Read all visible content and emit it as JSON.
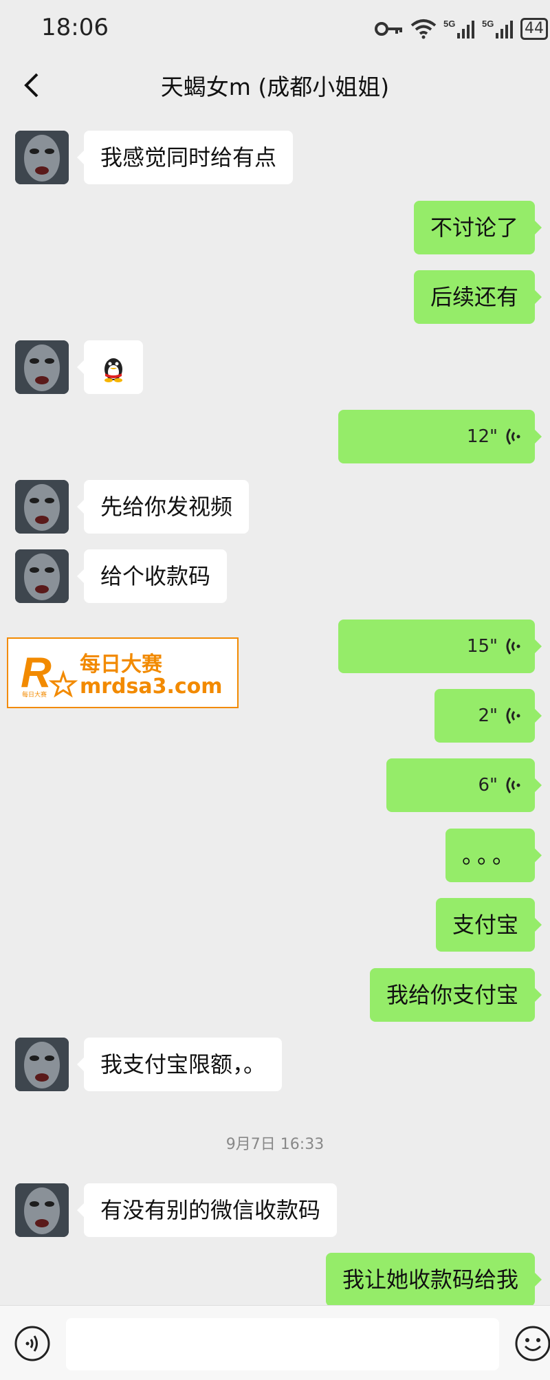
{
  "status": {
    "time": "18:06",
    "network1": "5G",
    "network2": "5G",
    "battery": "44"
  },
  "header": {
    "title": "天蝎女m (成都小姐姐)"
  },
  "messages": [
    {
      "side": "left",
      "text": "我感觉同时给有点"
    },
    {
      "side": "right",
      "text": "不讨论了"
    },
    {
      "side": "right",
      "text": "后续还有"
    },
    {
      "side": "left",
      "type": "sticker",
      "icon": "qq-penguin-icon"
    },
    {
      "side": "right",
      "type": "voice",
      "duration": "12\""
    },
    {
      "side": "left",
      "text": "先给你发视频"
    },
    {
      "side": "left",
      "text": "给个收款码"
    },
    {
      "side": "right",
      "type": "voice",
      "duration": "15\""
    },
    {
      "side": "right",
      "type": "voice",
      "duration": "2\""
    },
    {
      "side": "right",
      "type": "voice",
      "duration": "6\""
    },
    {
      "side": "right",
      "text": "。。。"
    },
    {
      "side": "right",
      "text": "支付宝"
    },
    {
      "side": "right",
      "text": "我给你支付宝"
    },
    {
      "side": "left",
      "text": "我支付宝限额，。"
    },
    {
      "side": "left",
      "text": "有没有别的微信收款码"
    },
    {
      "side": "right",
      "text": "我让她收款码给我"
    }
  ],
  "timestamp": "9月7日 16:33",
  "watermark": {
    "logo_letter": "R",
    "logo_sub": "每日大赛",
    "name": "每日大赛",
    "url": "mrdsa3.com"
  },
  "colors": {
    "background": "#ededed",
    "bubble_sent": "#95ec69",
    "bubble_received": "#ffffff",
    "accent_watermark": "#f28a00"
  }
}
